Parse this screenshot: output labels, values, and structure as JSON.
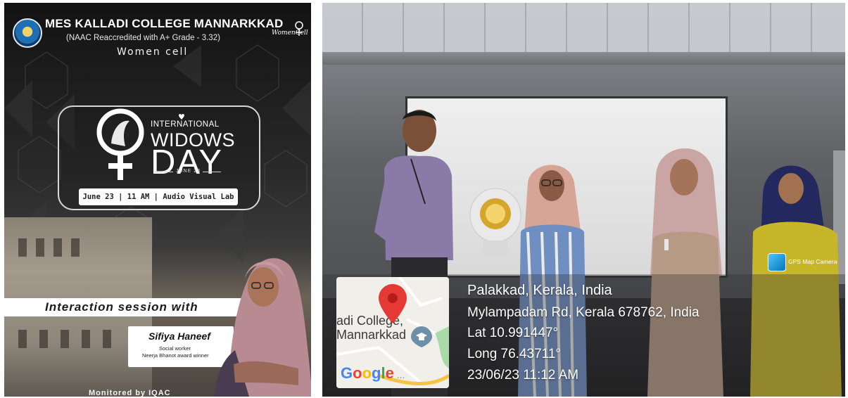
{
  "poster": {
    "college_name": "MES KALLADI COLLEGE MANNARKKAD",
    "accreditation": "(NAAC Reaccredited with A+ Grade - 3.32)",
    "cell_name": "Women cell",
    "women_cell_logo_text": "WomenCell",
    "event_title_line1": "INTERNATIONAL",
    "event_title_line2": "WIDOWS",
    "event_title_line3": "DAY",
    "event_title_date": "JUNE 23",
    "schedule": "June 23 | 11 AM | Audio Visual Lab",
    "session_heading": "Interaction session with",
    "speaker_name": "Sifiya Haneef",
    "speaker_role": "Social worker",
    "speaker_award": "Neerja Bhanot award winner",
    "monitored_by": "Monitored by IQAC"
  },
  "photo": {
    "map_label_line1": "adi College,",
    "map_label_line2": "Mannarkkad",
    "map_logo": "Google",
    "location_city": "Palakkad, Kerala, India",
    "location_address": "Mylampadam Rd, Kerala 678762, India",
    "latitude": "Lat 10.991447°",
    "longitude": "Long 76.43711°",
    "timestamp": "23/06/23 11:12 AM",
    "gps_app_label": "GPS Map Camera"
  },
  "colors": {
    "poster_bg": "#1e1e1e",
    "map_pin": "#e53935",
    "overlay_text": "#ffffff"
  }
}
